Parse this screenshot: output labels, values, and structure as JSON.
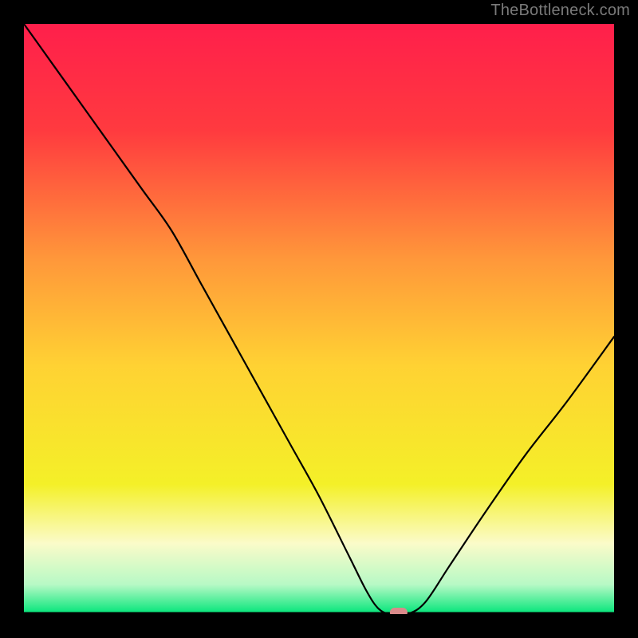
{
  "watermark": "TheBottleneck.com",
  "chart_data": {
    "type": "line",
    "title": "",
    "xlabel": "",
    "ylabel": "",
    "xlim": [
      0,
      100
    ],
    "ylim": [
      0,
      100
    ],
    "grid": false,
    "legend": false,
    "background_gradient_stops": [
      {
        "offset": 0.0,
        "color": "#ff1f4b"
      },
      {
        "offset": 0.18,
        "color": "#ff3a3f"
      },
      {
        "offset": 0.4,
        "color": "#ff983a"
      },
      {
        "offset": 0.58,
        "color": "#ffd233"
      },
      {
        "offset": 0.78,
        "color": "#f4f028"
      },
      {
        "offset": 0.88,
        "color": "#fbfbc9"
      },
      {
        "offset": 0.95,
        "color": "#b7f9c5"
      },
      {
        "offset": 1.0,
        "color": "#00e578"
      }
    ],
    "curve": {
      "name": "bottleneck-curve",
      "x": [
        0,
        5,
        10,
        15,
        20,
        25,
        30,
        35,
        40,
        45,
        50,
        55,
        58,
        60,
        62,
        65,
        68,
        72,
        78,
        85,
        92,
        100
      ],
      "y": [
        100,
        93,
        86,
        79,
        72,
        65,
        56,
        47,
        38,
        29,
        20,
        10,
        4,
        1,
        0,
        0,
        2,
        8,
        17,
        27,
        36,
        47
      ]
    },
    "marker": {
      "name": "current-point",
      "x": 63.5,
      "y": 0,
      "color": "#d98a8a",
      "shape": "rounded-rect"
    }
  }
}
